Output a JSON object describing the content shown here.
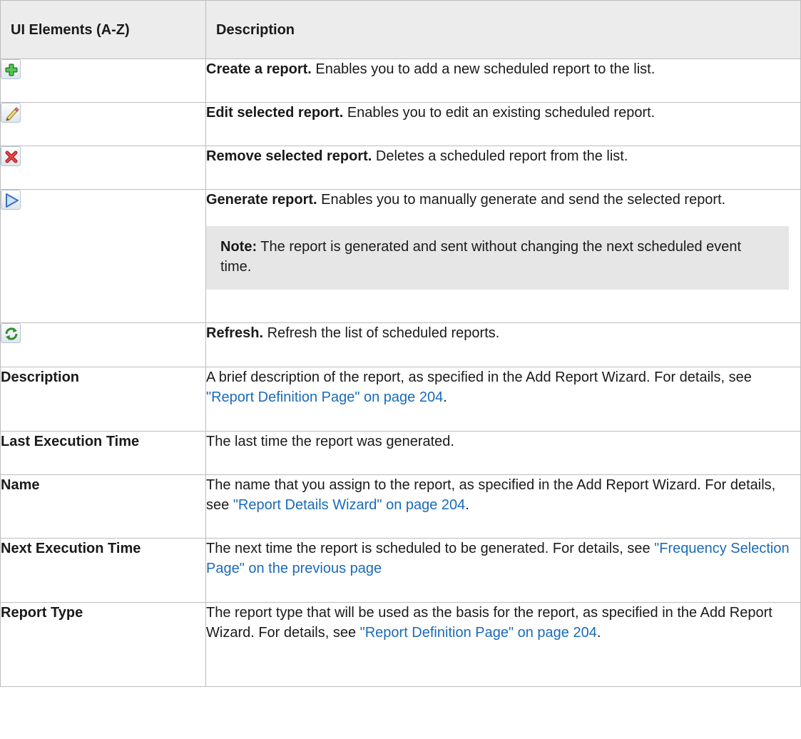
{
  "header": {
    "col1": "UI Elements (A-Z)",
    "col2": "Description"
  },
  "rows": {
    "create": {
      "icon": "add-icon",
      "title": "Create a report.",
      "text": " Enables you to add a new scheduled report to the list."
    },
    "edit": {
      "icon": "pencil-icon",
      "title": "Edit selected report.",
      "text": " Enables you to edit an existing scheduled report."
    },
    "remove": {
      "icon": "delete-icon",
      "title": "Remove selected report.",
      "text": " Deletes a scheduled report from the list."
    },
    "generate": {
      "icon": "play-icon",
      "title": "Generate report.",
      "text": " Enables you to manually generate and send the selected report.",
      "note_label": "Note:",
      "note_text": " The report is generated and sent without changing the next scheduled event time."
    },
    "refresh": {
      "icon": "refresh-icon",
      "title": "Refresh.",
      "text": " Refresh the list of scheduled reports."
    },
    "description": {
      "element": "Description",
      "text": "A brief description of the report, as specified in the Add Report Wizard. For details, see ",
      "link": "\"Report Definition Page\" on page 204",
      "after": "."
    },
    "last_execution": {
      "element": "Last Execution Time",
      "text": "The last time the report was generated."
    },
    "name": {
      "element": "Name",
      "text": "The name that you assign to the report, as specified in the Add Report Wizard. For details, see ",
      "link": "\"Report Details Wizard\" on page 204",
      "after": "."
    },
    "next_execution": {
      "element": "Next Execution Time",
      "text": "The next time the report is scheduled to be generated. For details, see ",
      "link": "\"Frequency Selection Page\" on the previous page",
      "after": ""
    },
    "report_type": {
      "element": "Report Type",
      "text": "The report type that will be used as the basis for the report, as specified in the Add Report Wizard. For details, see ",
      "link": "\"Report Definition Page\" on page 204",
      "after": "."
    }
  },
  "colors": {
    "header_bg": "#ececec",
    "link": "#1a6bb8",
    "note_bg": "#e6e6e6",
    "border": "#bdbdbd"
  }
}
